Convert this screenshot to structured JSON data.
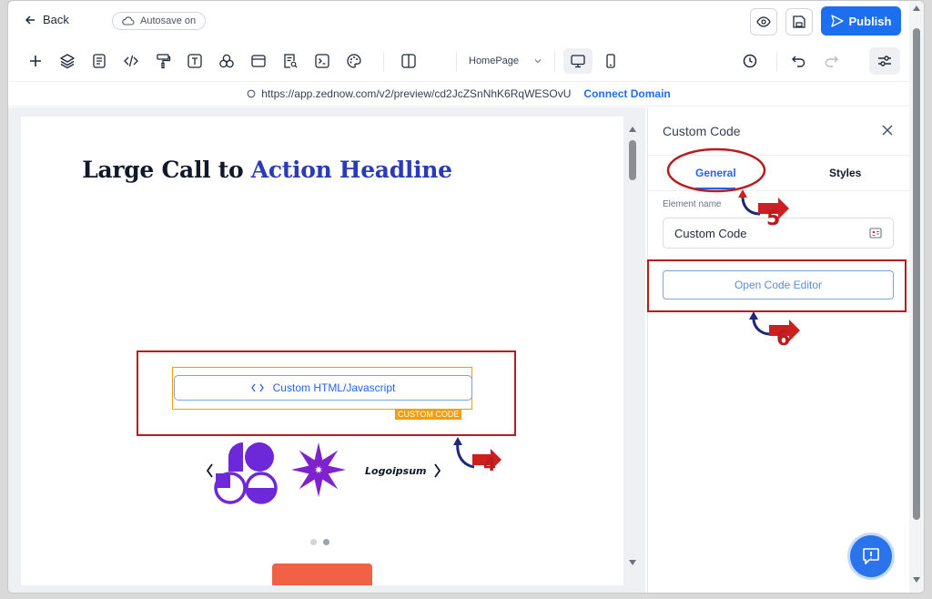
{
  "topbar": {
    "back_label": "Back",
    "autosave_label": "Autosave on",
    "publish_label": "Publish"
  },
  "toolbar": {
    "page_select_value": "HomePage",
    "tools": [
      "add-icon",
      "layers-icon",
      "pages-icon",
      "code-icon",
      "paint-roller-icon",
      "text-icon",
      "shapes-icon",
      "section-icon",
      "form-icon",
      "terminal-icon",
      "palette-icon",
      "columns-icon"
    ]
  },
  "urlbar": {
    "url": "https://app.zednow.com/v2/preview/cd2JcZSnNhK6RqWESOvU",
    "connect_label": "Connect Domain"
  },
  "canvas": {
    "headline_main": "Large Call to ",
    "headline_accent": "Action Headline",
    "custom_code_button": "Custom HTML/Javascript",
    "custom_code_tag": "CUSTOM CODE",
    "logo_text": "Logoipsum"
  },
  "panel": {
    "title": "Custom Code",
    "tab_general": "General",
    "tab_styles": "Styles",
    "element_name_label": "Element name",
    "element_name_value": "Custom Code",
    "open_editor_label": "Open Code Editor"
  },
  "annotations": {
    "step_4": "4",
    "step_5": "5",
    "step_6": "6"
  },
  "colors": {
    "accent": "#1d6ff0",
    "headline_accent": "#2a3bb8",
    "annotation": "#b91c1c",
    "custom_code_tag": "#f59e0b"
  }
}
